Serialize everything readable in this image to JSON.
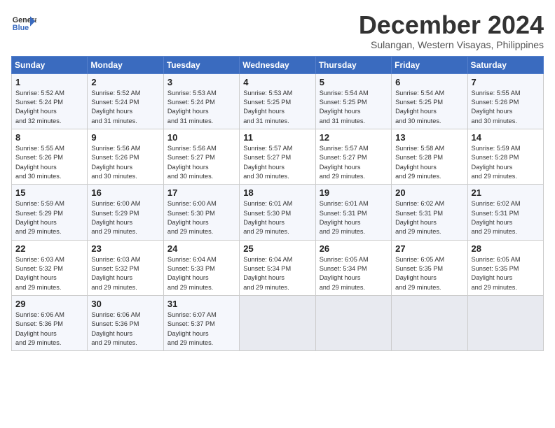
{
  "header": {
    "logo_line1": "General",
    "logo_line2": "Blue",
    "title": "December 2024",
    "location": "Sulangan, Western Visayas, Philippines"
  },
  "columns": [
    "Sunday",
    "Monday",
    "Tuesday",
    "Wednesday",
    "Thursday",
    "Friday",
    "Saturday"
  ],
  "weeks": [
    [
      {
        "day": "1",
        "sunrise": "5:52 AM",
        "sunset": "5:24 PM",
        "daylight": "11 hours and 32 minutes."
      },
      {
        "day": "2",
        "sunrise": "5:52 AM",
        "sunset": "5:24 PM",
        "daylight": "11 hours and 31 minutes."
      },
      {
        "day": "3",
        "sunrise": "5:53 AM",
        "sunset": "5:24 PM",
        "daylight": "11 hours and 31 minutes."
      },
      {
        "day": "4",
        "sunrise": "5:53 AM",
        "sunset": "5:25 PM",
        "daylight": "11 hours and 31 minutes."
      },
      {
        "day": "5",
        "sunrise": "5:54 AM",
        "sunset": "5:25 PM",
        "daylight": "11 hours and 31 minutes."
      },
      {
        "day": "6",
        "sunrise": "5:54 AM",
        "sunset": "5:25 PM",
        "daylight": "11 hours and 30 minutes."
      },
      {
        "day": "7",
        "sunrise": "5:55 AM",
        "sunset": "5:26 PM",
        "daylight": "11 hours and 30 minutes."
      }
    ],
    [
      {
        "day": "8",
        "sunrise": "5:55 AM",
        "sunset": "5:26 PM",
        "daylight": "11 hours and 30 minutes."
      },
      {
        "day": "9",
        "sunrise": "5:56 AM",
        "sunset": "5:26 PM",
        "daylight": "11 hours and 30 minutes."
      },
      {
        "day": "10",
        "sunrise": "5:56 AM",
        "sunset": "5:27 PM",
        "daylight": "11 hours and 30 minutes."
      },
      {
        "day": "11",
        "sunrise": "5:57 AM",
        "sunset": "5:27 PM",
        "daylight": "11 hours and 30 minutes."
      },
      {
        "day": "12",
        "sunrise": "5:57 AM",
        "sunset": "5:27 PM",
        "daylight": "11 hours and 29 minutes."
      },
      {
        "day": "13",
        "sunrise": "5:58 AM",
        "sunset": "5:28 PM",
        "daylight": "11 hours and 29 minutes."
      },
      {
        "day": "14",
        "sunrise": "5:59 AM",
        "sunset": "5:28 PM",
        "daylight": "11 hours and 29 minutes."
      }
    ],
    [
      {
        "day": "15",
        "sunrise": "5:59 AM",
        "sunset": "5:29 PM",
        "daylight": "11 hours and 29 minutes."
      },
      {
        "day": "16",
        "sunrise": "6:00 AM",
        "sunset": "5:29 PM",
        "daylight": "11 hours and 29 minutes."
      },
      {
        "day": "17",
        "sunrise": "6:00 AM",
        "sunset": "5:30 PM",
        "daylight": "11 hours and 29 minutes."
      },
      {
        "day": "18",
        "sunrise": "6:01 AM",
        "sunset": "5:30 PM",
        "daylight": "11 hours and 29 minutes."
      },
      {
        "day": "19",
        "sunrise": "6:01 AM",
        "sunset": "5:31 PM",
        "daylight": "11 hours and 29 minutes."
      },
      {
        "day": "20",
        "sunrise": "6:02 AM",
        "sunset": "5:31 PM",
        "daylight": "11 hours and 29 minutes."
      },
      {
        "day": "21",
        "sunrise": "6:02 AM",
        "sunset": "5:31 PM",
        "daylight": "11 hours and 29 minutes."
      }
    ],
    [
      {
        "day": "22",
        "sunrise": "6:03 AM",
        "sunset": "5:32 PM",
        "daylight": "11 hours and 29 minutes."
      },
      {
        "day": "23",
        "sunrise": "6:03 AM",
        "sunset": "5:32 PM",
        "daylight": "11 hours and 29 minutes."
      },
      {
        "day": "24",
        "sunrise": "6:04 AM",
        "sunset": "5:33 PM",
        "daylight": "11 hours and 29 minutes."
      },
      {
        "day": "25",
        "sunrise": "6:04 AM",
        "sunset": "5:34 PM",
        "daylight": "11 hours and 29 minutes."
      },
      {
        "day": "26",
        "sunrise": "6:05 AM",
        "sunset": "5:34 PM",
        "daylight": "11 hours and 29 minutes."
      },
      {
        "day": "27",
        "sunrise": "6:05 AM",
        "sunset": "5:35 PM",
        "daylight": "11 hours and 29 minutes."
      },
      {
        "day": "28",
        "sunrise": "6:05 AM",
        "sunset": "5:35 PM",
        "daylight": "11 hours and 29 minutes."
      }
    ],
    [
      {
        "day": "29",
        "sunrise": "6:06 AM",
        "sunset": "5:36 PM",
        "daylight": "11 hours and 29 minutes."
      },
      {
        "day": "30",
        "sunrise": "6:06 AM",
        "sunset": "5:36 PM",
        "daylight": "11 hours and 29 minutes."
      },
      {
        "day": "31",
        "sunrise": "6:07 AM",
        "sunset": "5:37 PM",
        "daylight": "11 hours and 29 minutes."
      },
      null,
      null,
      null,
      null
    ]
  ]
}
